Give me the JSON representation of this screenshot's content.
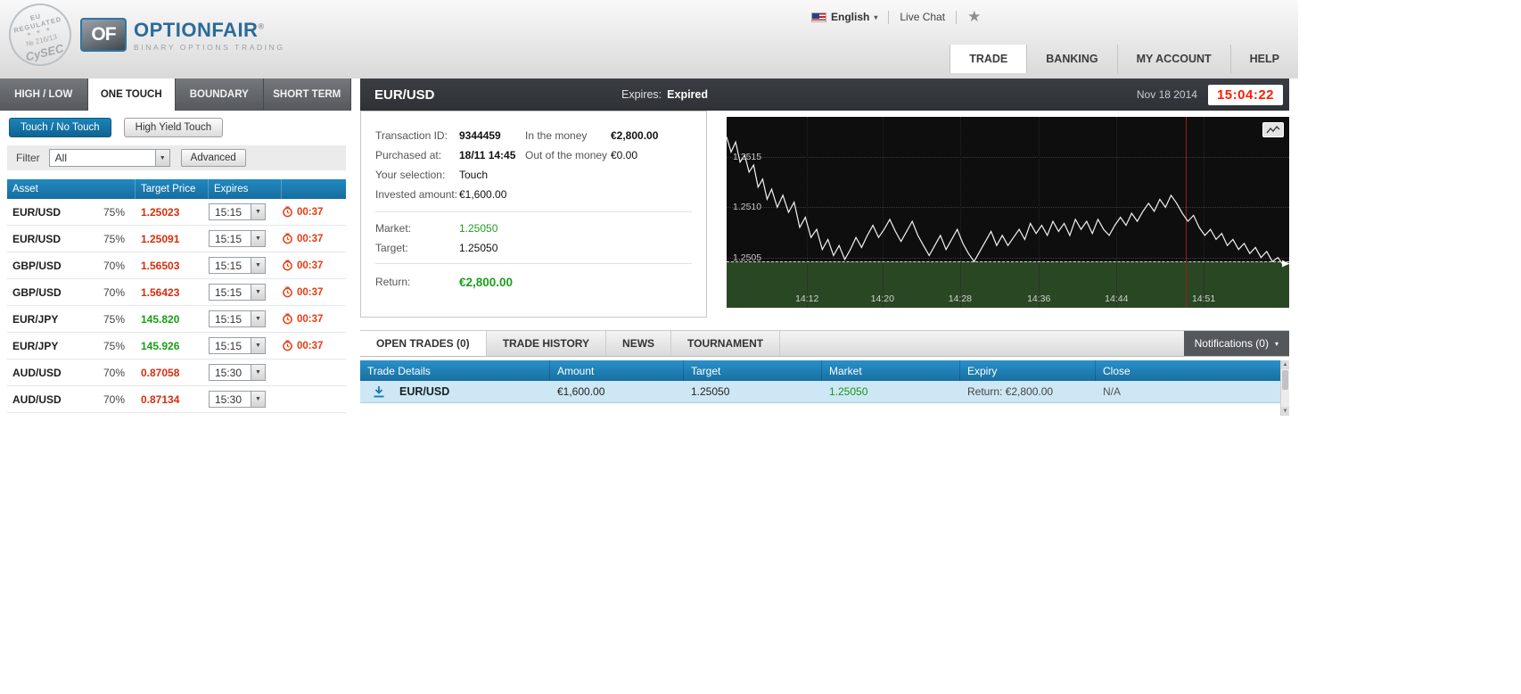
{
  "icons": {
    "caret_down": "▼",
    "caret_small": "▾",
    "star": "★",
    "stars": "★ ★ ★",
    "arrow_up": "▲",
    "arrow_down": "▼"
  },
  "header": {
    "badge": {
      "line1": "EU REGULATED",
      "line2": "№ 216/13",
      "line3": "CySEC"
    },
    "logo": {
      "mark": "OF",
      "name": "OPTIONFAIR",
      "reg": "®",
      "tagline": "BINARY OPTIONS TRADING"
    },
    "language": "English",
    "live_chat": "Live Chat",
    "nav_tabs": [
      {
        "label": "TRADE",
        "active": true
      },
      {
        "label": "BANKING",
        "active": false
      },
      {
        "label": "MY ACCOUNT",
        "active": false
      },
      {
        "label": "HELP",
        "active": false
      }
    ]
  },
  "trade_nav": {
    "tabs": [
      {
        "label": "HIGH / LOW",
        "active": false
      },
      {
        "label": "ONE TOUCH",
        "active": true
      },
      {
        "label": "BOUNDARY",
        "active": false
      },
      {
        "label": "SHORT TERM",
        "active": false
      }
    ]
  },
  "instrument_bar": {
    "symbol": "EUR/USD",
    "expires_label": "Expires:",
    "expires_value": "Expired",
    "date": "Nov 18 2014",
    "clock": "15:04:22"
  },
  "left_panel": {
    "mode_buttons": [
      {
        "label": "Touch / No Touch",
        "active": true
      },
      {
        "label": "High Yield Touch",
        "active": false
      }
    ],
    "filter": {
      "label": "Filter",
      "selected": "All",
      "advanced_label": "Advanced"
    },
    "asset_table": {
      "headers": [
        "Asset",
        "Target Price",
        "Expires",
        ""
      ],
      "rows": [
        {
          "asset": "EUR/USD",
          "payout": "75%",
          "price": "1.25023",
          "trend": "down",
          "expires": "15:15",
          "timer": "00:37"
        },
        {
          "asset": "EUR/USD",
          "payout": "75%",
          "price": "1.25091",
          "trend": "down",
          "expires": "15:15",
          "timer": "00:37"
        },
        {
          "asset": "GBP/USD",
          "payout": "70%",
          "price": "1.56503",
          "trend": "down",
          "expires": "15:15",
          "timer": "00:37"
        },
        {
          "asset": "GBP/USD",
          "payout": "70%",
          "price": "1.56423",
          "trend": "down",
          "expires": "15:15",
          "timer": "00:37"
        },
        {
          "asset": "EUR/JPY",
          "payout": "75%",
          "price": "145.820",
          "trend": "up",
          "expires": "15:15",
          "timer": "00:37"
        },
        {
          "asset": "EUR/JPY",
          "payout": "75%",
          "price": "145.926",
          "trend": "up",
          "expires": "15:15",
          "timer": "00:37"
        },
        {
          "asset": "AUD/USD",
          "payout": "70%",
          "price": "0.87058",
          "trend": "down",
          "expires": "15:30",
          "timer": ""
        },
        {
          "asset": "AUD/USD",
          "payout": "70%",
          "price": "0.87134",
          "trend": "down",
          "expires": "15:30",
          "timer": ""
        }
      ]
    }
  },
  "trade_details": {
    "fields_left": [
      {
        "label": "Transaction ID:",
        "value": "9344459",
        "bold": true
      },
      {
        "label": "Purchased at:",
        "value": "18/11 14:45",
        "bold": true
      },
      {
        "label": "Your selection:",
        "value": "Touch",
        "bold": false
      },
      {
        "label": "Invested amount:",
        "value": "€1,600.00",
        "bold": false
      }
    ],
    "fields_right": [
      {
        "label": "In the money",
        "value": "€2,800.00",
        "bold": true
      },
      {
        "label": "Out of the money",
        "value": "€0.00",
        "bold": false
      }
    ],
    "market": {
      "label": "Market:",
      "value": "1.25050"
    },
    "target": {
      "label": "Target:",
      "value": "1.25050"
    },
    "return": {
      "label": "Return:",
      "value": "€2,800.00"
    }
  },
  "chart_data": {
    "type": "line",
    "symbol": "EUR/USD",
    "ylim": [
      1.25,
      1.2519
    ],
    "target_level": 1.25046,
    "current_time_pct": 81.6,
    "y_ticks": [
      {
        "label": "1.2515",
        "value": 1.2515
      },
      {
        "label": "1.2510",
        "value": 1.251
      },
      {
        "label": "1.2505",
        "value": 1.2505
      }
    ],
    "x_ticks": [
      {
        "label": "14:12",
        "pct": 14.3
      },
      {
        "label": "14:20",
        "pct": 27.7
      },
      {
        "label": "14:28",
        "pct": 41.5
      },
      {
        "label": "14:36",
        "pct": 55.5
      },
      {
        "label": "14:44",
        "pct": 69.3
      },
      {
        "label": "14:51",
        "pct": 84.8
      }
    ],
    "series": [
      {
        "name": "EUR/USD",
        "points": [
          [
            0,
            1.2517
          ],
          [
            0.8,
            1.25155
          ],
          [
            1.6,
            1.25165
          ],
          [
            2.4,
            1.25145
          ],
          [
            3.2,
            1.25152
          ],
          [
            4,
            1.25135
          ],
          [
            4.8,
            1.25142
          ],
          [
            5.6,
            1.2512
          ],
          [
            6.4,
            1.25128
          ],
          [
            7.2,
            1.25108
          ],
          [
            8,
            1.25118
          ],
          [
            9,
            1.251
          ],
          [
            10,
            1.25112
          ],
          [
            11,
            1.25095
          ],
          [
            12,
            1.25105
          ],
          [
            13,
            1.2508
          ],
          [
            14,
            1.2509
          ],
          [
            15,
            1.2507
          ],
          [
            16,
            1.25078
          ],
          [
            17,
            1.25058
          ],
          [
            18,
            1.25068
          ],
          [
            19,
            1.25052
          ],
          [
            20,
            1.25062
          ],
          [
            21,
            1.25048
          ],
          [
            22,
            1.25058
          ],
          [
            23,
            1.2507
          ],
          [
            24,
            1.2506
          ],
          [
            25,
            1.25072
          ],
          [
            26,
            1.25082
          ],
          [
            27,
            1.2507
          ],
          [
            28,
            1.25078
          ],
          [
            29,
            1.25088
          ],
          [
            30,
            1.25076
          ],
          [
            31,
            1.25066
          ],
          [
            32,
            1.25076
          ],
          [
            33,
            1.25086
          ],
          [
            34,
            1.25072
          ],
          [
            35,
            1.25062
          ],
          [
            36,
            1.25052
          ],
          [
            37,
            1.25062
          ],
          [
            38,
            1.25072
          ],
          [
            39,
            1.25058
          ],
          [
            40,
            1.25068
          ],
          [
            41,
            1.25078
          ],
          [
            42,
            1.25064
          ],
          [
            43,
            1.25054
          ],
          [
            44,
            1.25046
          ],
          [
            45,
            1.25056
          ],
          [
            46,
            1.25066
          ],
          [
            47,
            1.25076
          ],
          [
            48,
            1.25062
          ],
          [
            49,
            1.25072
          ],
          [
            50,
            1.25062
          ],
          [
            51,
            1.2507
          ],
          [
            52,
            1.25078
          ],
          [
            53,
            1.25068
          ],
          [
            54,
            1.25084
          ],
          [
            55,
            1.25074
          ],
          [
            56,
            1.25082
          ],
          [
            57,
            1.25072
          ],
          [
            58,
            1.25086
          ],
          [
            59,
            1.25076
          ],
          [
            60,
            1.25084
          ],
          [
            61,
            1.25072
          ],
          [
            62,
            1.25088
          ],
          [
            63,
            1.25078
          ],
          [
            64,
            1.25086
          ],
          [
            65,
            1.25074
          ],
          [
            66,
            1.25088
          ],
          [
            67,
            1.25078
          ],
          [
            68,
            1.25072
          ],
          [
            69,
            1.25082
          ],
          [
            70,
            1.2509
          ],
          [
            71,
            1.25082
          ],
          [
            72,
            1.25094
          ],
          [
            73,
            1.25086
          ],
          [
            74,
            1.25096
          ],
          [
            75,
            1.25104
          ],
          [
            76,
            1.25096
          ],
          [
            77,
            1.25108
          ],
          [
            78,
            1.251
          ],
          [
            79,
            1.25112
          ],
          [
            80,
            1.25104
          ],
          [
            81,
            1.25094
          ],
          [
            82,
            1.25086
          ],
          [
            83,
            1.25092
          ],
          [
            84,
            1.2508
          ],
          [
            85,
            1.25072
          ],
          [
            86,
            1.25078
          ],
          [
            87,
            1.25068
          ],
          [
            88,
            1.25074
          ],
          [
            89,
            1.25062
          ],
          [
            90,
            1.25068
          ],
          [
            91,
            1.25058
          ],
          [
            92,
            1.25064
          ],
          [
            93,
            1.25054
          ],
          [
            94,
            1.2506
          ],
          [
            95,
            1.2505
          ],
          [
            96,
            1.25056
          ],
          [
            97,
            1.25046
          ],
          [
            98,
            1.2505
          ],
          [
            99,
            1.25042
          ],
          [
            100,
            1.25044
          ]
        ]
      }
    ]
  },
  "bottom_panel": {
    "tabs": [
      {
        "label": "OPEN TRADES (0)",
        "active": true
      },
      {
        "label": "TRADE HISTORY",
        "active": false
      },
      {
        "label": "NEWS",
        "active": false
      },
      {
        "label": "TOURNAMENT",
        "active": false
      }
    ],
    "notifications": "Notifications (0)",
    "trades_table": {
      "headers": [
        "Trade Details",
        "Amount",
        "Target",
        "Market",
        "Expiry",
        "Close"
      ],
      "rows": [
        {
          "asset": "EUR/USD",
          "amount": "€1,600.00",
          "target": "1.25050",
          "market": "1.25050",
          "expiry": "Return: €2,800.00",
          "close": "N/A"
        }
      ]
    }
  }
}
